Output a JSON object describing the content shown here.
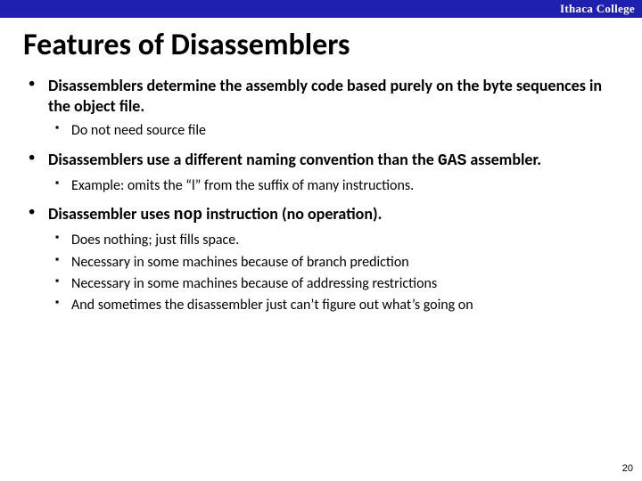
{
  "header": {
    "brand": "Ithaca College"
  },
  "title": "Features of Disassemblers",
  "bullets": [
    {
      "text": "Disassemblers determine the assembly code based purely on the byte sequences in the object file.",
      "subs": [
        "Do not need source file"
      ]
    },
    {
      "text_a": " Disassemblers use a different naming convention than the ",
      "code": "GAS",
      "text_b": " assembler.",
      "subs": [
        "Example:  omits the “l” from the suffix of many instructions."
      ]
    },
    {
      "text_a": " Disassembler uses ",
      "code": "nop",
      "text_b": " instruction (no operation).",
      "subs": [
        "Does nothing; just fills space.",
        "Necessary in some machines because of branch prediction",
        "Necessary in some machines because of addressing restrictions",
        "And sometimes the disassembler just can’t figure out what’s going on"
      ]
    }
  ],
  "page_number": "20"
}
